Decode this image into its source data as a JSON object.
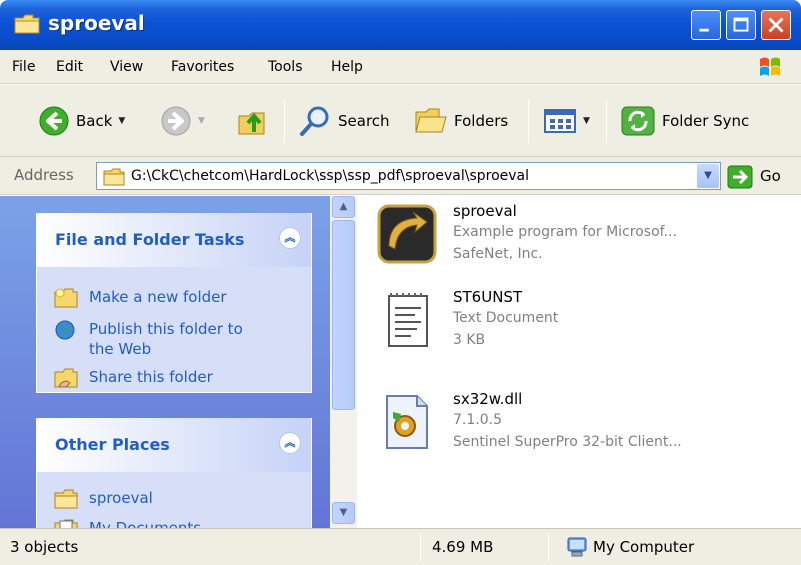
{
  "window": {
    "title": "sproeval",
    "buttons": [
      "minimize",
      "maximize",
      "close"
    ]
  },
  "menu": {
    "items": [
      "File",
      "Edit",
      "View",
      "Favorites",
      "Tools",
      "Help"
    ]
  },
  "toolbar": {
    "back_label": "Back",
    "search_label": "Search",
    "folders_label": "Folders",
    "folder_sync_label": "Folder Sync"
  },
  "address": {
    "label": "Address",
    "value": "G:\\CkC\\chetcom\\HardLock\\ssp\\ssp_pdf\\sproeval\\sproeval",
    "go_label": "Go"
  },
  "tasks_panel": {
    "title": "File and Folder Tasks",
    "items": [
      {
        "label": "Make a new folder",
        "icon": "new-folder-icon"
      },
      {
        "label": "Publish this folder to the Web",
        "icon": "publish-web-icon"
      },
      {
        "label": "Share this folder",
        "icon": "share-folder-icon"
      }
    ]
  },
  "places_panel": {
    "title": "Other Places",
    "items": [
      {
        "label": "sproeval",
        "icon": "folder-icon"
      },
      {
        "label": "My Documents",
        "icon": "my-documents-icon"
      }
    ]
  },
  "files": [
    {
      "name": "sproeval",
      "line2": "Example program for Microsof...",
      "line3": "SafeNet, Inc.",
      "icon": "application-icon"
    },
    {
      "name": "ST6UNST",
      "line2": "Text Document",
      "line3": "3 KB",
      "icon": "text-document-icon"
    },
    {
      "name": "sx32w.dll",
      "line2": "7.1.0.5",
      "line3": "Sentinel SuperPro 32-bit Client...",
      "icon": "dll-icon"
    }
  ],
  "status": {
    "objects": "3 objects",
    "size": "4.69 MB",
    "location": "My Computer"
  },
  "colors": {
    "title_bar": "#0a54d6",
    "task_pane": "#6d8ee0",
    "link_blue": "#215dc6",
    "chrome": "#efeee3"
  }
}
